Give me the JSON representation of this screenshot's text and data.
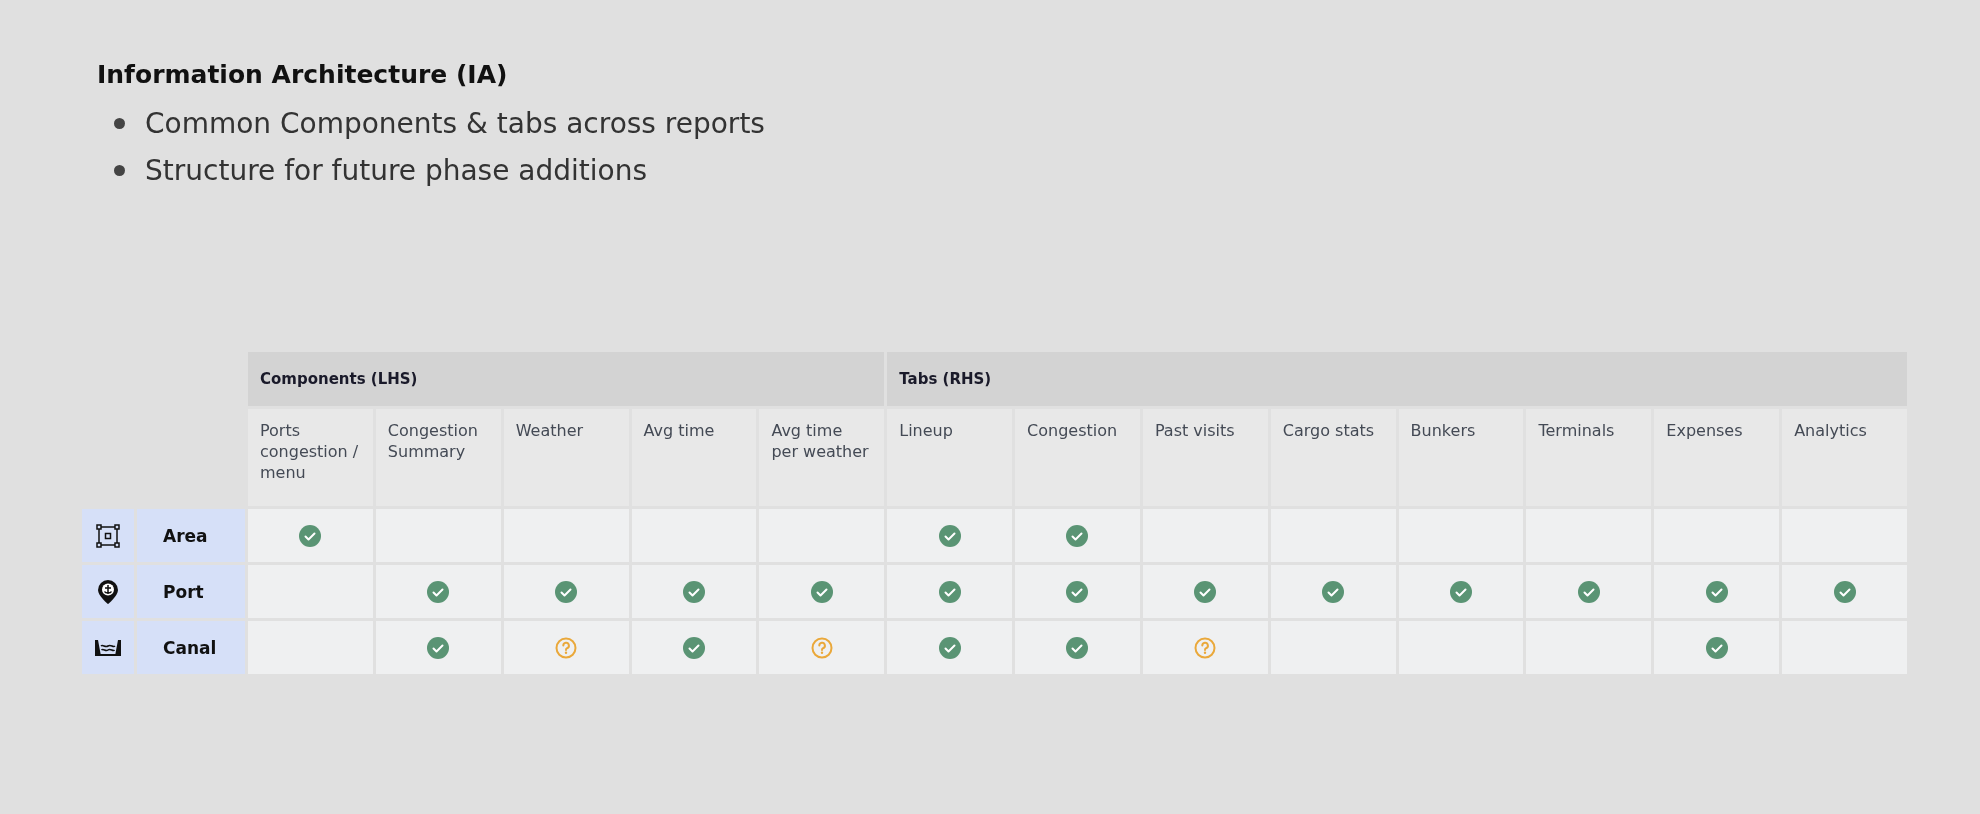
{
  "title": "Information Architecture (IA)",
  "bullets": [
    "Common Components & tabs across reports",
    "Structure for future phase additions"
  ],
  "table": {
    "groups": [
      {
        "label": "Components (LHS)",
        "columns": [
          "Ports congestion / menu",
          "Congestion Summary",
          "Weather",
          "Avg time",
          "Avg time per weather"
        ]
      },
      {
        "label": "Tabs (RHS)",
        "columns": [
          "Lineup",
          "Congestion",
          "Past visits",
          "Cargo stats",
          "Bunkers",
          "Terminals",
          "Expenses",
          "Analytics"
        ]
      }
    ],
    "rows": [
      {
        "label": "Area",
        "kind": "area",
        "cells": [
          {
            "kind": "check"
          },
          {
            "kind": "empty"
          },
          {
            "kind": "empty"
          },
          {
            "kind": "empty"
          },
          {
            "kind": "empty"
          },
          {
            "kind": "check"
          },
          {
            "kind": "check"
          },
          {
            "kind": "empty"
          },
          {
            "kind": "empty"
          },
          {
            "kind": "empty"
          },
          {
            "kind": "empty"
          },
          {
            "kind": "empty"
          },
          {
            "kind": "empty"
          }
        ]
      },
      {
        "label": "Port",
        "kind": "port",
        "cells": [
          {
            "kind": "empty"
          },
          {
            "kind": "check"
          },
          {
            "kind": "check"
          },
          {
            "kind": "check"
          },
          {
            "kind": "check"
          },
          {
            "kind": "check"
          },
          {
            "kind": "check"
          },
          {
            "kind": "check"
          },
          {
            "kind": "check"
          },
          {
            "kind": "check"
          },
          {
            "kind": "check"
          },
          {
            "kind": "check"
          },
          {
            "kind": "check"
          }
        ]
      },
      {
        "label": "Canal",
        "kind": "canal",
        "cells": [
          {
            "kind": "empty"
          },
          {
            "kind": "check"
          },
          {
            "kind": "question"
          },
          {
            "kind": "check"
          },
          {
            "kind": "question"
          },
          {
            "kind": "check"
          },
          {
            "kind": "check"
          },
          {
            "kind": "question"
          },
          {
            "kind": "empty"
          },
          {
            "kind": "empty"
          },
          {
            "kind": "empty"
          },
          {
            "kind": "check"
          },
          {
            "kind": "empty"
          }
        ]
      }
    ]
  }
}
